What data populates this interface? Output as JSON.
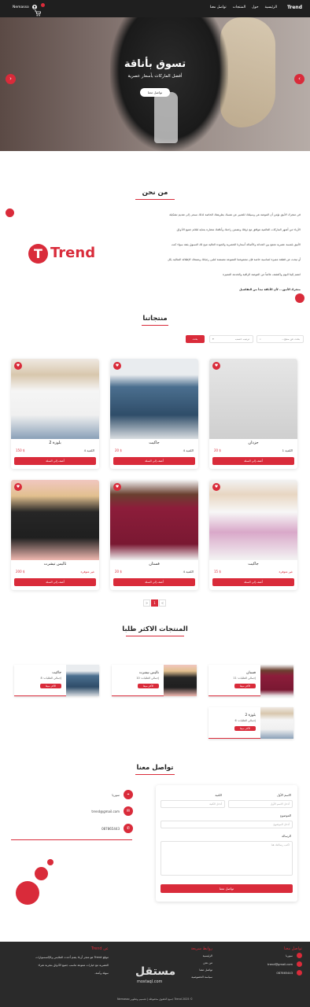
{
  "nav": {
    "brand": "Trend",
    "links": [
      "الرئيسية",
      "حول",
      "المنتجات",
      "تواصل معنا"
    ],
    "user": "Nemasso"
  },
  "hero": {
    "title": "تسوق بأناقة",
    "subtitle": "أفضل الماركات بأسعار عصرية",
    "button": "تواصل معنا",
    "prev_icon": "chevron-left-icon",
    "next_icon": "chevron-right-icon"
  },
  "about": {
    "title": "من نحن",
    "paragraphs": [
      "في متجرك الأنيق نؤمن أن الموضة هي وسيلتك للتعبير عن نفسك بطريقتك الخاصة لذلك نسعى إلى تقديم تشكيلة",
      "الأزياء من أشهر الماركات العالمية تتوافق مع ذوقك وتضمن راحتك وأناقتك مختارة بعناية لتلائم جميع الأذواق",
      "الأنيق بلمسة عصرية تجمع بين الحداثة والأصالة أسعارنا الحصرية والجودة العالية تتيح لك التسوق بثقة سواء كنت",
      "أو تبحث عن قطعة مميزة لمناسبة خاصة فإن مجموعتنا المتنوعة مصممة لتلبي رغباتك وتمنحك الإطلالة المثالية بكل",
      "انضم إلينا اليوم واكتشف عالماً من الموضة الراقية والخدمة المميزة"
    ],
    "closing": "متجرك الأنيق... لأن الأناقة تبدأ من التفاصيل",
    "logo_letter": "T",
    "logo_text": "Trend"
  },
  "products": {
    "title": "منتجاتنا",
    "search_placeholder": "بحث عن منتج...",
    "sort_label": "ترتيب حسب",
    "search_button": "بحث",
    "items": [
      {
        "name": "جزدان",
        "price": "20 $",
        "stock": "الكمية 1",
        "out": false,
        "add": "أضف إلى السلة",
        "img": "bag"
      },
      {
        "name": "جاكيت",
        "price": "20 $",
        "stock": "الكمية 4",
        "out": false,
        "add": "أضف إلى السلة",
        "img": "jacket"
      },
      {
        "name": "بلوزة 2",
        "price": "150 $",
        "stock": "الكمية 4",
        "out": false,
        "add": "أضف إلى السلة",
        "img": "tee"
      },
      {
        "name": "جاكيت",
        "price": "15 $",
        "stock": "غير متوفرة",
        "out": true,
        "add": "أضف إلى السلة",
        "img": "pink"
      },
      {
        "name": "فستان",
        "price": "20 $",
        "stock": "الكمية 4",
        "out": false,
        "add": "أضف إلى السلة",
        "img": "dress"
      },
      {
        "name": "تاليس تيشرت",
        "price": "200 $",
        "stock": "غير متوفرة",
        "out": true,
        "add": "أضف إلى السلة",
        "img": "skull"
      }
    ],
    "pages": [
      "<",
      "1",
      ">"
    ]
  },
  "best": {
    "title": "المنتجات الاكثر طلبا",
    "tag": "الأكثر مبيعا",
    "items": [
      {
        "name": "فستان",
        "count": "إجمالي الطلبات: 11",
        "img": "dress"
      },
      {
        "name": "تاليس تيشرت",
        "count": "إجمالي الطلبات: 10",
        "img": "skull"
      },
      {
        "name": "جاكيت",
        "count": "إجمالي الطلبات: 8",
        "img": "jacket"
      },
      {
        "name": "بلوزة 2",
        "count": "إجمالي الطلبات: 6",
        "img": "tee"
      }
    ]
  },
  "contact": {
    "title": "تواصل معنا",
    "location": "سوريا",
    "email": "trend@gmail.com",
    "phone": "087865443",
    "form": {
      "first_name_label": "الاسم الأول",
      "first_name_placeholder": "أدخل الاسم الأول",
      "last_name_label": "الكنية",
      "last_name_placeholder": "أدخل الكنية",
      "subject_label": "الموضوع",
      "subject_placeholder": "أدخل الموضوع",
      "message_label": "الرسالة",
      "message_placeholder": "اكتب رسالتك هنا",
      "send": "تواصل معنا"
    }
  },
  "footer": {
    "about_title": "عن Trend",
    "about_text": [
      "موقع Trend هو متجر أزياء يضم أحدث الملابس والإكسسوارات",
      "العصرية مع خيارات متنوعة تناسب جميع الأذواق بتجربة شراء",
      "سهلة وآمنة."
    ],
    "links_title": "روابط سريعة",
    "links": [
      "الرئيسية",
      "من نحن",
      "تواصل معنا",
      "سياسة الخصوصية"
    ],
    "contact_title": "تواصل معنا",
    "contact": [
      "سوريا",
      "trend@gmail.com",
      "087865443"
    ],
    "bottom": "© 2025 Trend جميع الحقوق محفوظة | تصميم وتطوير Nemasso",
    "watermark": "مستقل",
    "watermark_url": "mostaql.com"
  },
  "colors": {
    "accent": "#d92b3a",
    "dark": "#1f1f1f"
  }
}
